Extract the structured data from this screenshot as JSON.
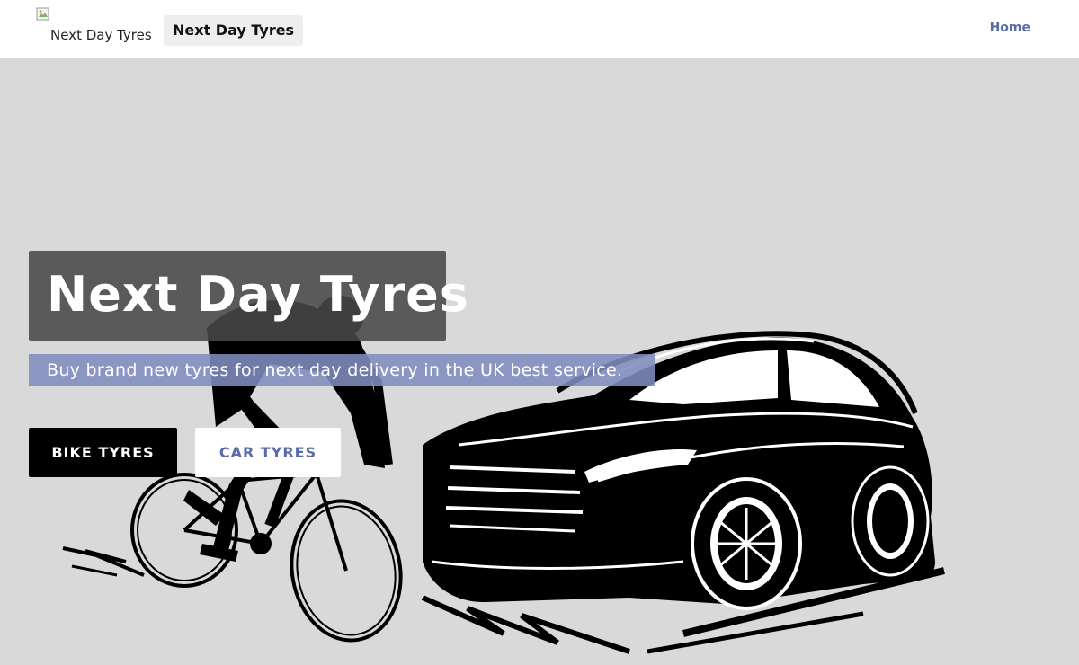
{
  "header": {
    "logo_alt": "Next Day Tyres",
    "logo_icon": "broken-image-icon",
    "brand_label": "Next Day Tyres",
    "nav": [
      {
        "label": "Home"
      }
    ]
  },
  "hero": {
    "title": "Next Day Tyres",
    "subtitle": "Buy brand new tyres for next day delivery in the UK best service.",
    "buttons": {
      "bike_label": "BIKE TYRES",
      "car_label": "CAR TYRES"
    },
    "illustration_icons": [
      "cyclist-icon",
      "bicycle-icon",
      "car-icon"
    ]
  },
  "colors": {
    "hero_background": "#d9d9d9",
    "title_box": "#484848",
    "subtitle_box": "#7f8cbe",
    "accent": "#5a6ca8",
    "dark_button": "#000000"
  }
}
